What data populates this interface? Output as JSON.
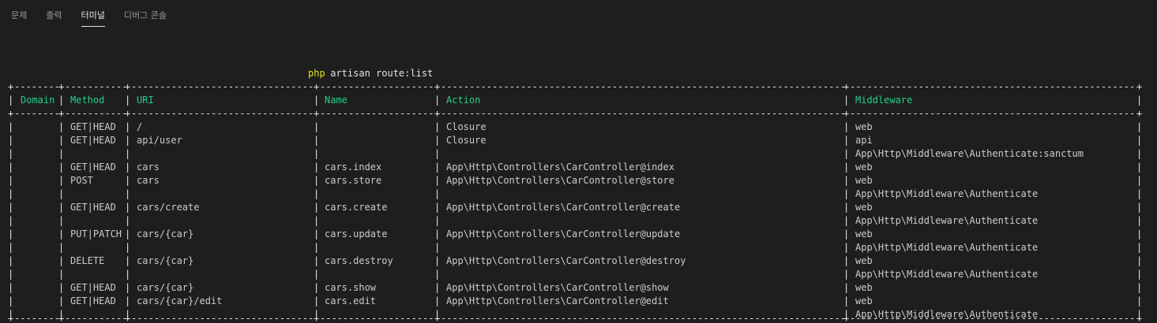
{
  "panel_tabs": [
    {
      "id": "problems",
      "label": "문제",
      "active": false
    },
    {
      "id": "output",
      "label": "출력",
      "active": false
    },
    {
      "id": "terminal",
      "label": "터미널",
      "active": true
    },
    {
      "id": "debug-console",
      "label": "디버그 콘솔",
      "active": false
    }
  ],
  "terminal": {
    "command_keyword": "php",
    "command_args": " artisan route:list",
    "headers": [
      "Domain",
      "Method",
      "URI",
      "Name",
      "Action",
      "Middleware"
    ],
    "rows": [
      [
        "",
        "GET|HEAD",
        "/",
        "",
        "Closure",
        "web"
      ],
      [
        "",
        "GET|HEAD",
        "api/user",
        "",
        "Closure",
        "api"
      ],
      [
        "",
        "",
        "",
        "",
        "",
        "App\\Http\\Middleware\\Authenticate:sanctum"
      ],
      [
        "",
        "GET|HEAD",
        "cars",
        "cars.index",
        "App\\Http\\Controllers\\CarController@index",
        "web"
      ],
      [
        "",
        "POST",
        "cars",
        "cars.store",
        "App\\Http\\Controllers\\CarController@store",
        "web"
      ],
      [
        "",
        "",
        "",
        "",
        "",
        "App\\Http\\Middleware\\Authenticate"
      ],
      [
        "",
        "GET|HEAD",
        "cars/create",
        "cars.create",
        "App\\Http\\Controllers\\CarController@create",
        "web"
      ],
      [
        "",
        "",
        "",
        "",
        "",
        "App\\Http\\Middleware\\Authenticate"
      ],
      [
        "",
        "PUT|PATCH",
        "cars/{car}",
        "cars.update",
        "App\\Http\\Controllers\\CarController@update",
        "web"
      ],
      [
        "",
        "",
        "",
        "",
        "",
        "App\\Http\\Middleware\\Authenticate"
      ],
      [
        "",
        "DELETE",
        "cars/{car}",
        "cars.destroy",
        "App\\Http\\Controllers\\CarController@destroy",
        "web"
      ],
      [
        "",
        "",
        "",
        "",
        "",
        "App\\Http\\Middleware\\Authenticate"
      ],
      [
        "",
        "GET|HEAD",
        "cars/{car}",
        "cars.show",
        "App\\Http\\Controllers\\CarController@show",
        "web"
      ],
      [
        "",
        "GET|HEAD",
        "cars/{car}/edit",
        "cars.edit",
        "App\\Http\\Controllers\\CarController@edit",
        "web"
      ],
      [
        "",
        "",
        "",
        "",
        "",
        "App\\Http\\Middleware\\Authenticate"
      ]
    ],
    "colors": {
      "background": "#1e1e1e",
      "header_text": "#23d18b",
      "command_keyword": "#e5e510",
      "text": "#cccccc",
      "active_tab": "#e7e7e7",
      "inactive_tab": "#969696"
    }
  }
}
